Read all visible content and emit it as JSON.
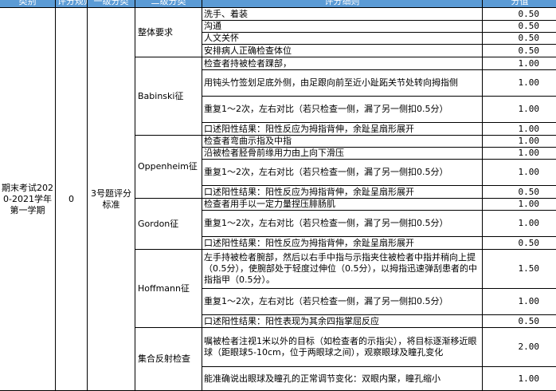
{
  "headers": {
    "category": "类别",
    "score_rule": "评分规则",
    "level1": "一级分类",
    "level2": "二级分类",
    "detail": "评分细则",
    "value": "分值"
  },
  "category_text": "期末考试2020-2021学年第一学期",
  "score_rule_value": "0",
  "level1_text": "3号题评分标准",
  "groups": [
    {
      "name": "整体要求",
      "rows": [
        {
          "text": "洗手、着装",
          "value": "0.50"
        },
        {
          "text": "沟通",
          "value": "0.50"
        },
        {
          "text": "人文关怀",
          "value": "0.50"
        },
        {
          "text": "安排病人正确检查体位",
          "value": "0.50"
        }
      ]
    },
    {
      "name": "Babinski征",
      "rows": [
        {
          "text": "检查者持被检者踝部，",
          "value": "1.00"
        },
        {
          "text": "用钝头竹签划足底外侧，由足跟向前至近小趾跖关节处转向拇指侧",
          "value": "1.00"
        },
        {
          "text": "重复1～2次，左右对比（若只检查一侧，漏了另一侧扣0.5分）",
          "value": "1.00"
        },
        {
          "text": "口述阳性结果：阳性反应为拇指背伸，余趾呈扇形展开",
          "value": "1.00"
        }
      ]
    },
    {
      "name": "Oppenheim征",
      "rows": [
        {
          "text": "检查者弯曲示指及中指",
          "value": "1.00"
        },
        {
          "text": "沿被检者胫骨前缘用力由上向下滑压",
          "value": "1.00"
        },
        {
          "text": "重复1～2次，左右对比（若只检查一侧，漏了另一侧扣0.5分）",
          "value": "1.00"
        },
        {
          "text": "口述阳性结果：阳性反应为拇指背伸，余趾呈扇形展开",
          "value": "0.50"
        }
      ]
    },
    {
      "name": "Gordon征",
      "rows": [
        {
          "text": "检查者用手以一定力量捏压腓肠肌",
          "value": "1.00"
        },
        {
          "text": "重复1～2次，左右对比（若只检查一侧，漏了另一侧扣0.5分）",
          "value": "1.00"
        },
        {
          "text": "口述阳性结果：阳性反应为拇指背伸，余趾呈扇形展开",
          "value": "0.50"
        }
      ]
    },
    {
      "name": "Hoffmann征",
      "rows": [
        {
          "text": "左手持被检者腕部，然后以右手中指与示指夹住被检者中指并稍向上提（0.5分），使腕部处于轻度过伸位（0.5分），以拇指迅速弹刮患者的中指指甲（0.5分）。",
          "value": "1.50"
        },
        {
          "text": "重复1～2次，左右对比（若只检查一侧，漏了另一侧扣0.5分）",
          "value": "1.00"
        },
        {
          "text": "口述阳性结果：阳性表现为其余四指掌屈反应",
          "value": "0.50"
        }
      ]
    },
    {
      "name": "集合反射检查",
      "rows": [
        {
          "text": "嘱被检者注视1米以外的目标（如检查者的示指尖），将目标逐渐移近眼球（距眼球5-10cm，位于两眼球之间），观察眼球及瞳孔变化",
          "value": "2.00"
        },
        {
          "text": "能准确说出眼球及瞳孔的正常调节变化：双眼内聚，瞳孔缩小",
          "value": "1.00"
        }
      ]
    }
  ]
}
